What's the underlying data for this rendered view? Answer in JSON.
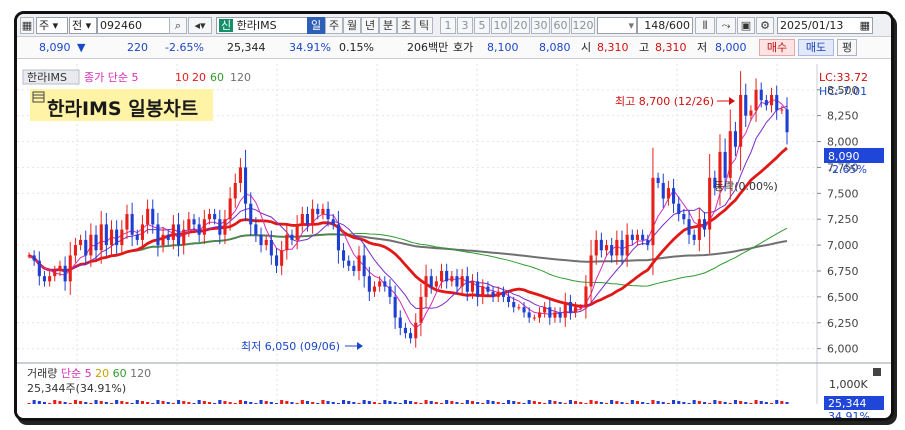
{
  "toolbar": {
    "item1": "주",
    "item2": "전",
    "code": "092460",
    "stock_tag": "신",
    "stock_name": "한라IMS",
    "period_tabs": [
      "일",
      "주",
      "월",
      "년",
      "분",
      "초",
      "틱"
    ],
    "active_period": "일",
    "interval_buttons": [
      "1",
      "3",
      "5",
      "10",
      "20",
      "30",
      "60",
      "120"
    ],
    "count": "148/600",
    "date": "2025/01/13"
  },
  "quote": {
    "price": "8,090",
    "change_arrow": "▼",
    "change": "220",
    "change_pct": "-2.65%",
    "volume": "25,344",
    "vol_ratio": "34.91%",
    "turnover": "0.15%",
    "amount": "206백만",
    "hoga_label": "호가",
    "ask": "8,100",
    "bid": "8,080",
    "open_label": "시",
    "open": "8,310",
    "high_label": "고",
    "high": "8,310",
    "low_label": "저",
    "low": "8,000",
    "buy_button": "매수",
    "sell_button": "매도",
    "eval_button": "평"
  },
  "legend": {
    "name": "한라IMS",
    "price_label": "종가 단순",
    "periods": [
      "5",
      "10",
      "20",
      "60",
      "120"
    ],
    "lc": "LC:33.72",
    "hc": "HC:-7.01"
  },
  "overlay_title": "한라IMS 일봉차트",
  "annotations": {
    "max": "최고 8,700 (12/26)",
    "min": "최저 6,050 (09/06)",
    "ref": "(0.00%)",
    "ref_prefix": "동락"
  },
  "current_price_label": "8,090",
  "current_change_label": "-2.65%",
  "volume_legend": {
    "name": "거래량",
    "type": "단순",
    "periods": [
      "5",
      "20",
      "60",
      "120"
    ],
    "value": "25,344주(34.91%)",
    "axis_max": "1,000K",
    "vol_box": "25,344",
    "vol_pct": "34.91%"
  },
  "chart_data": {
    "type": "candlestick",
    "ylim": [
      5900,
      8720
    ],
    "yticks": [
      "8,500",
      "8,250",
      "8,000",
      "7,750",
      "7,500",
      "7,250",
      "7,000",
      "6,750",
      "6,500",
      "6,250",
      "6,000"
    ],
    "close": [
      6900,
      6850,
      6700,
      6650,
      6700,
      6750,
      6800,
      6650,
      6900,
      7000,
      7050,
      6900,
      7100,
      6950,
      7200,
      7000,
      7150,
      7000,
      7150,
      7300,
      7100,
      7050,
      7200,
      7350,
      7200,
      7000,
      7100,
      7050,
      7200,
      7000,
      7150,
      7250,
      7200,
      7100,
      7250,
      7300,
      7250,
      7100,
      7250,
      7450,
      7600,
      7750,
      7400,
      7200,
      7100,
      7000,
      7050,
      6900,
      6800,
      6950,
      7100,
      7050,
      7200,
      7300,
      7200,
      7350,
      7300,
      7350,
      7250,
      7200,
      6950,
      6850,
      6800,
      6750,
      6900,
      6700,
      6550,
      6600,
      6650,
      6600,
      6500,
      6300,
      6200,
      6150,
      6100,
      6250,
      6500,
      6700,
      6600,
      6650,
      6750,
      6650,
      6700,
      6600,
      6700,
      6550,
      6650,
      6500,
      6600,
      6550,
      6500,
      6550,
      6500,
      6450,
      6400,
      6400,
      6350,
      6300,
      6300,
      6350,
      6400,
      6300,
      6350,
      6300,
      6450,
      6350,
      6400,
      6400,
      6600,
      6900,
      7050,
      6950,
      7000,
      6900,
      7050,
      6900,
      7100,
      7050,
      7100,
      7050,
      7000,
      7650,
      7600,
      7450,
      7550,
      7400,
      7300,
      7250,
      7100,
      7050,
      7250,
      7150,
      7650,
      7550,
      7900,
      7650,
      8100,
      7950,
      8450,
      8250,
      8300,
      8500,
      8400,
      8350,
      8450,
      8300,
      8310,
      8090
    ]
  },
  "colors": {
    "up": "#e8201a",
    "down": "#1e3fd0",
    "ma5": "#d62db8",
    "ma10": "#7a2ec9",
    "ma20": "#e01818",
    "ma60": "#2f9a2f",
    "ma120": "#707070"
  }
}
